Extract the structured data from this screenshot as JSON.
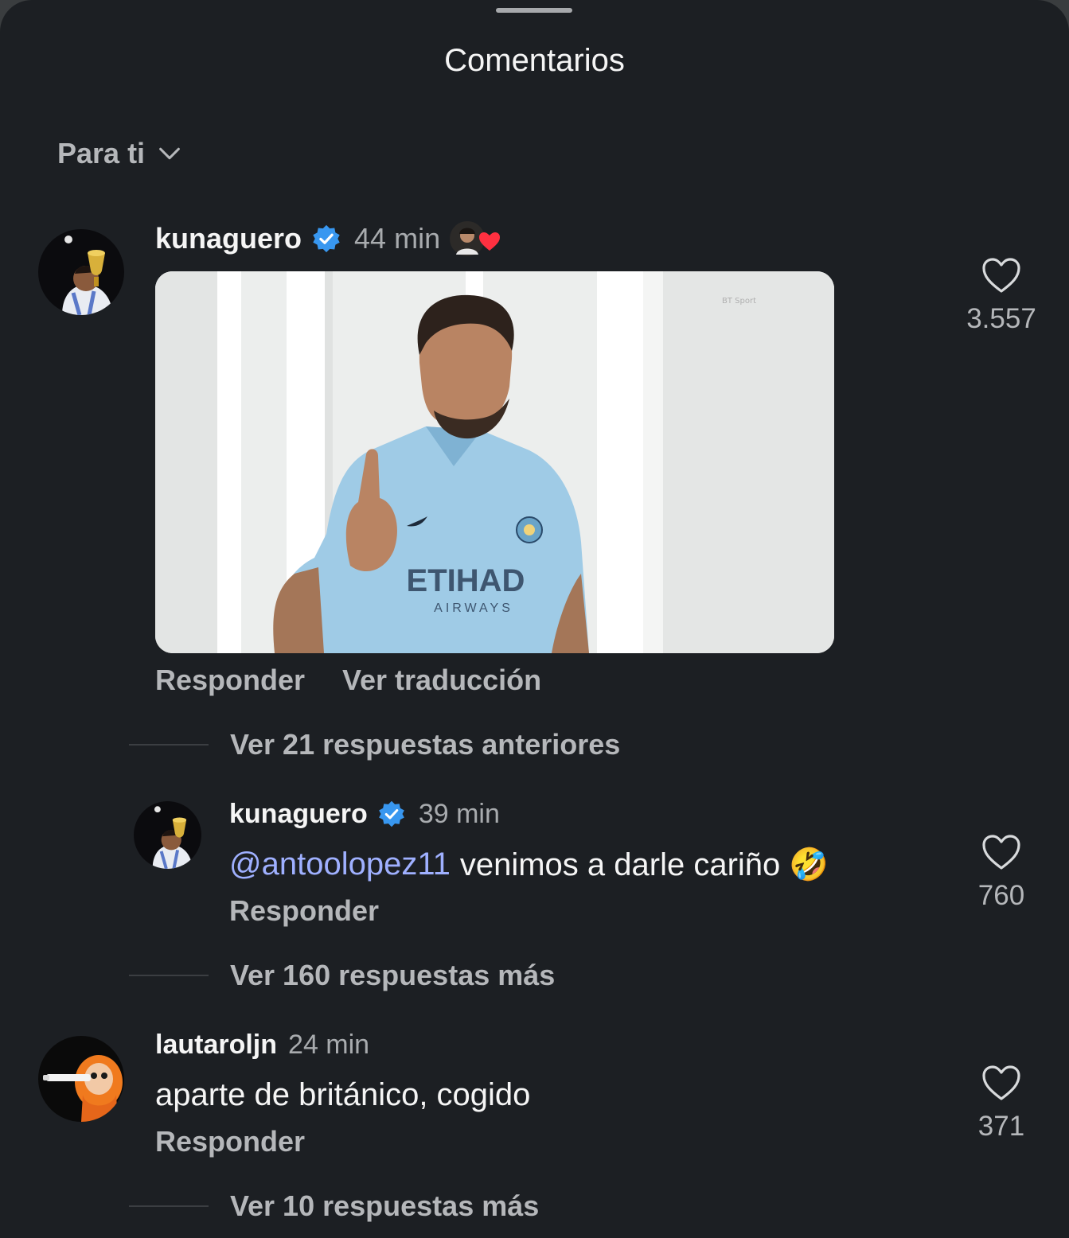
{
  "sheet": {
    "title": "Comentarios"
  },
  "sort": {
    "label": "Para ti"
  },
  "comments": [
    {
      "username": "kunaguero",
      "time": "44 min",
      "verified": true,
      "liked_by_author": true,
      "media": "gif",
      "gif_text": {
        "shirt_sponsor": "ETIHAD",
        "shirt_sub": "AIRWAYS",
        "watermark": "BT Sport"
      },
      "actions": {
        "reply": "Responder",
        "translate": "Ver traducción"
      },
      "likes": "3.557",
      "replies_toggle": "Ver 21 respuestas anteriores",
      "replies": [
        {
          "username": "kunaguero",
          "time": "39 min",
          "verified": true,
          "mention": "@antoolopez11",
          "text": "venimos a darle cariño 🤣",
          "actions": {
            "reply": "Responder"
          },
          "likes": "760"
        }
      ],
      "more_replies": "Ver 160 respuestas más"
    },
    {
      "username": "lautaroljn",
      "time": "24 min",
      "verified": false,
      "text": "aparte de británico, cogido",
      "actions": {
        "reply": "Responder"
      },
      "likes": "371",
      "more_replies": "Ver 10 respuestas más"
    }
  ],
  "colors": {
    "background": "#1c1f23",
    "text": "#f5f5f5",
    "secondary_text": "#b5b7ba",
    "mention": "#9fb0ff",
    "verified": "#3897f0",
    "heart_red": "#ff3040"
  }
}
